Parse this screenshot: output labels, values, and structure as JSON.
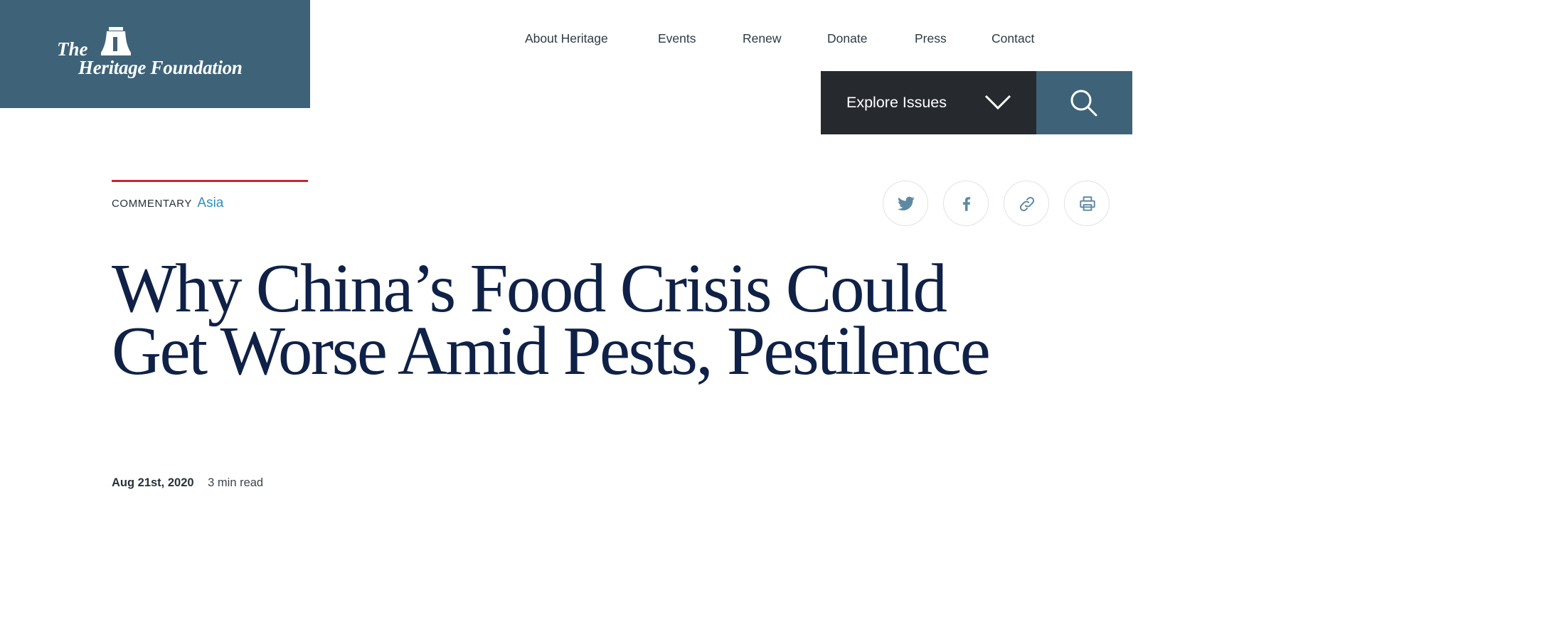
{
  "logo": {
    "line1": "The",
    "line2": "Heritage Foundation",
    "icon": "liberty-bell-icon"
  },
  "topnav": {
    "items": [
      "About Heritage",
      "Events",
      "Renew",
      "Donate",
      "Press",
      "Contact"
    ]
  },
  "explore": {
    "label": "Explore Issues",
    "icon": "chevron-down-icon"
  },
  "search": {
    "icon": "search-icon"
  },
  "article": {
    "type": "COMMENTARY",
    "topic": "Asia",
    "title": "Why China’s Food Crisis Could Get Worse Amid Pests, Pestilence",
    "date": "Aug 21st, 2020",
    "read_time": "3 min read"
  },
  "share": {
    "icons": [
      "twitter-icon",
      "facebook-icon",
      "link-icon",
      "print-icon"
    ]
  },
  "colors": {
    "brand": "#3e6378",
    "dark": "#262a2e",
    "accent_red": "#c8262c",
    "link_blue": "#2a8fbf",
    "headline_navy": "#0f2147"
  }
}
